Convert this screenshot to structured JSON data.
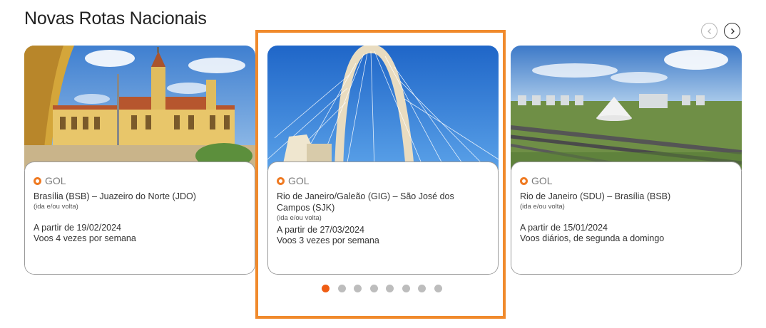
{
  "section": {
    "title": "Novas Rotas Nacionais"
  },
  "nav": {
    "prev_icon": "chevron-left-icon",
    "next_icon": "chevron-right-icon"
  },
  "cards": [
    {
      "airline": "GOL",
      "route": "Brasília (BSB) – Juazeiro do Norte (JDO)",
      "note": "(ida e/ou volta)",
      "start": "A partir de 19/02/2024",
      "frequency": "Voos 4 vezes por semana"
    },
    {
      "airline": "GOL",
      "route": "Rio de Janeiro/Galeão (GIG) – São José dos Campos (SJK)",
      "note": "(ida e/ou volta)",
      "start": "A partir de 27/03/2024",
      "frequency": "Voos 3 vezes por semana"
    },
    {
      "airline": "GOL",
      "route": "Rio de Janeiro (SDU) – Brasília (BSB)",
      "note": "(ida e/ou volta)",
      "start": "A partir de 15/01/2024",
      "frequency": "Voos diários, de segunda a domingo"
    }
  ],
  "pagination": {
    "total": 8,
    "active_index": 0
  },
  "colors": {
    "highlight": "#f08a2c",
    "brand_orange": "#ef7a22",
    "dot_active": "#ef5d14",
    "dot_inactive": "#bdbdbd"
  }
}
